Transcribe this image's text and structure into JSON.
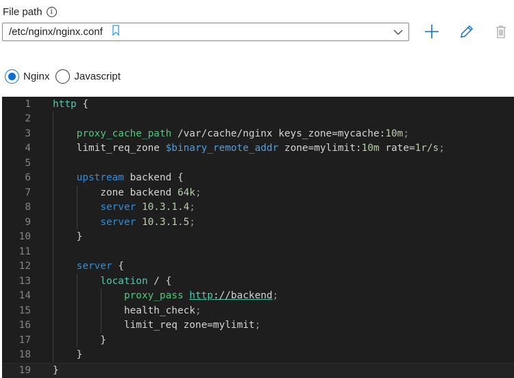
{
  "file_path": {
    "label": "File path",
    "info_icon": "i",
    "value": "/etc/nginx/nginx.conf"
  },
  "toolbar": {
    "add": "plus-icon",
    "edit": "pencil-icon",
    "delete": "trash-icon"
  },
  "colors": {
    "accent": "#0a6fd6",
    "editor_bg": "#1e1e1e"
  },
  "language": {
    "options": [
      {
        "label": "Nginx",
        "selected": true
      },
      {
        "label": "Javascript",
        "selected": false
      }
    ]
  },
  "editor": {
    "current_line": 19,
    "lines": [
      [
        [
          "http",
          "dir"
        ],
        [
          " {",
          ""
        ]
      ],
      [],
      [
        [
          "    ",
          ""
        ],
        [
          "proxy_cache_path",
          "proxy"
        ],
        [
          " /var/cache/nginx keys_zone=mycache:",
          ""
        ],
        [
          "10m",
          "num"
        ],
        [
          ";",
          "punc"
        ]
      ],
      [
        [
          "    limit_req_zone ",
          ""
        ],
        [
          "$binary_remote_addr",
          "var"
        ],
        [
          " zone=mylimit:",
          ""
        ],
        [
          "10m",
          "num"
        ],
        [
          " rate=",
          ""
        ],
        [
          "1r/s",
          "num"
        ],
        [
          ";",
          "punc"
        ]
      ],
      [],
      [
        [
          "    ",
          ""
        ],
        [
          "upstream",
          "kw"
        ],
        [
          " backend {",
          ""
        ]
      ],
      [
        [
          "        zone backend ",
          ""
        ],
        [
          "64k",
          "num"
        ],
        [
          ";",
          "punc"
        ]
      ],
      [
        [
          "        ",
          ""
        ],
        [
          "server",
          "kw"
        ],
        [
          " ",
          ""
        ],
        [
          "10.3.1.4",
          "num"
        ],
        [
          ";",
          "punc"
        ]
      ],
      [
        [
          "        ",
          ""
        ],
        [
          "server",
          "kw"
        ],
        [
          " ",
          ""
        ],
        [
          "10.3.1.5",
          "num"
        ],
        [
          ";",
          "punc"
        ]
      ],
      [
        [
          "    }",
          ""
        ]
      ],
      [],
      [
        [
          "    ",
          ""
        ],
        [
          "server",
          "kw"
        ],
        [
          " {",
          ""
        ]
      ],
      [
        [
          "        ",
          ""
        ],
        [
          "location",
          "dir"
        ],
        [
          " / {",
          ""
        ]
      ],
      [
        [
          "            ",
          ""
        ],
        [
          "proxy_pass",
          "proxy"
        ],
        [
          " ",
          ""
        ],
        [
          "http",
          "urlp"
        ],
        [
          "://backend",
          "url"
        ],
        [
          ";",
          "punc"
        ]
      ],
      [
        [
          "            health_check",
          ""
        ],
        [
          ";",
          "punc"
        ]
      ],
      [
        [
          "            limit_req zone=mylimit",
          ""
        ],
        [
          ";",
          "punc"
        ]
      ],
      [
        [
          "        }",
          ""
        ]
      ],
      [
        [
          "    }",
          ""
        ]
      ],
      [
        [
          "}",
          ""
        ]
      ]
    ]
  }
}
